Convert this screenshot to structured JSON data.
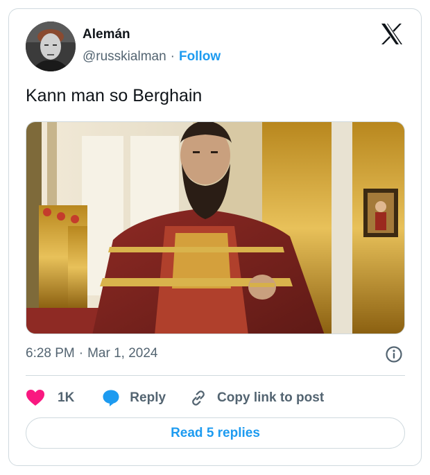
{
  "author": {
    "display_name": "Alemán",
    "handle": "@russkialman",
    "separator": "·",
    "follow_label": "Follow"
  },
  "tweet": {
    "text": "Kann man so Berghain",
    "time": "6:28 PM",
    "separator": "·",
    "date": "Mar 1, 2024"
  },
  "actions": {
    "like_count": "1K",
    "reply_label": "Reply",
    "copy_link_label": "Copy link to post"
  },
  "read_replies_label": "Read 5 replies",
  "icons": {
    "brand": "x-logo-icon",
    "info": "info-icon",
    "like": "heart-icon",
    "reply": "speech-bubble-icon",
    "copy": "link-icon"
  },
  "colors": {
    "accent": "#1d9bf0",
    "like": "#f91880",
    "text_primary": "#0f1419",
    "text_secondary": "#536471",
    "border": "#cfd9de"
  }
}
